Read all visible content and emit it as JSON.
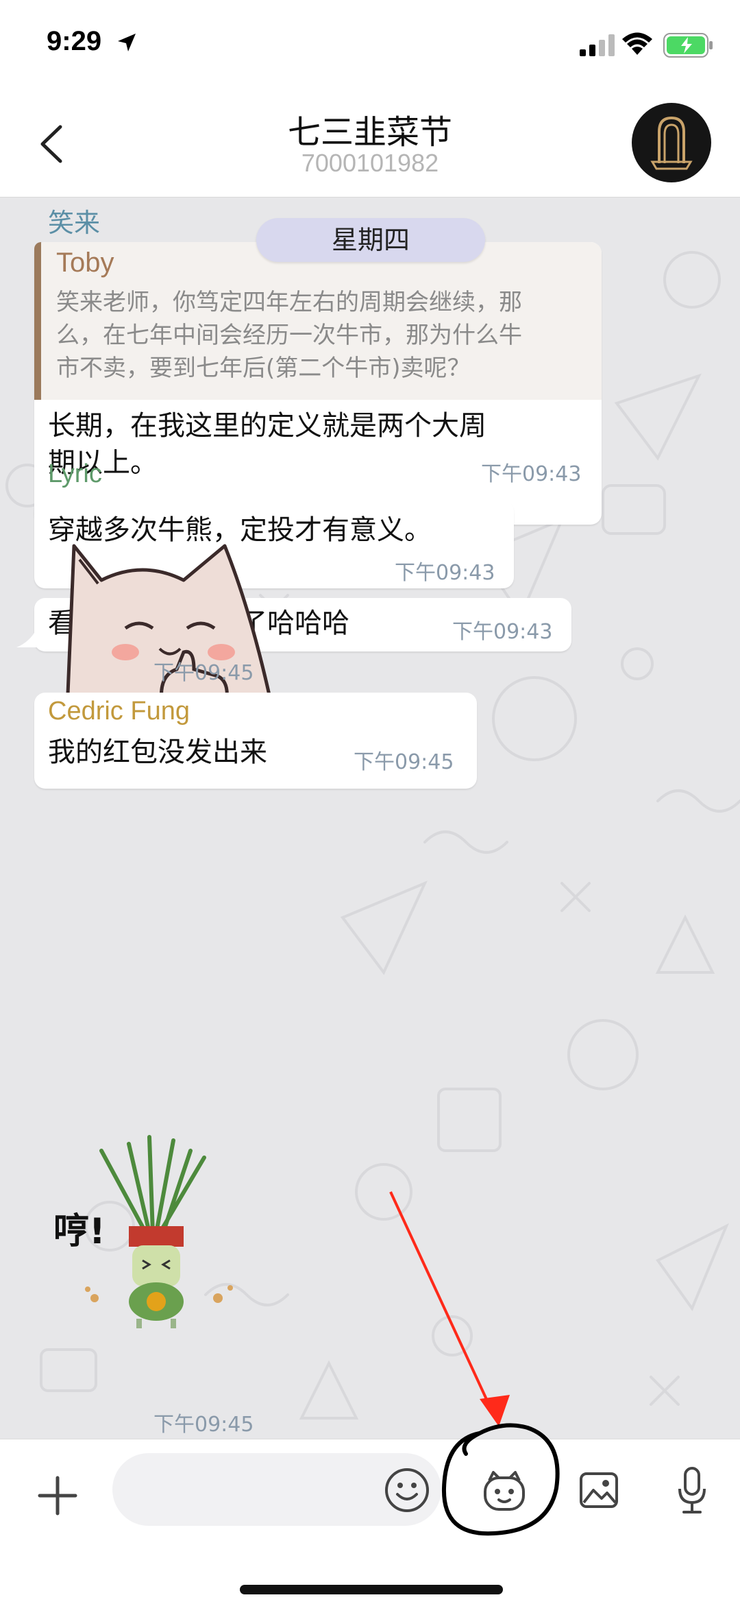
{
  "status_bar": {
    "time": "9:29"
  },
  "header": {
    "title": "七三韭菜节",
    "subtitle": "7000101982"
  },
  "chat": {
    "date_divider": "星期四",
    "messages": [
      {
        "sender": "笑来",
        "quote": {
          "name": "Toby",
          "lines": [
            "笑来老师，你笃定四年左右的周期会继续，那",
            "么，在七年中间会经历一次牛市，那为什么牛",
            "市不卖，要到七年后(第二个牛市)卖呢？"
          ]
        },
        "lines": [
          "长期，在我这里的定义就是两个大周",
          "期以上。"
        ],
        "time": "下午09:43"
      },
      {
        "lines": [
          "穿越多次牛熊，定投才有意义。"
        ],
        "time": "下午09:43"
      },
      {
        "lines": [
          "看来都看直播去了哈哈哈"
        ],
        "time": "下午09:43"
      },
      {
        "sender": "Lyric",
        "sticker": "cat-thumbs-up-sticker",
        "time": "下午09:45"
      },
      {
        "sender": "Cedric Fung",
        "lines": [
          "我的红包没发出来"
        ],
        "time": "下午09:45"
      },
      {
        "sticker": "leek-bitcoin-sticker",
        "sticker_text": "哼!",
        "time": "下午09:45"
      }
    ]
  },
  "input_bar": {
    "placeholder": ""
  },
  "colors": {
    "sender_xiaolai": "#5b8fa6",
    "sender_lyric": "#5e9a6a",
    "sender_cedric": "#c2993c",
    "quote_accent": "#9b7a5c",
    "date_pill": "#d8d8ee",
    "annotation": "#ff2a1a"
  },
  "icons": [
    "back-icon",
    "location-arrow-icon",
    "signal-icon",
    "wifi-icon",
    "battery-icon",
    "plus-icon",
    "emoji-icon",
    "bot-icon",
    "photo-icon",
    "mic-icon"
  ]
}
